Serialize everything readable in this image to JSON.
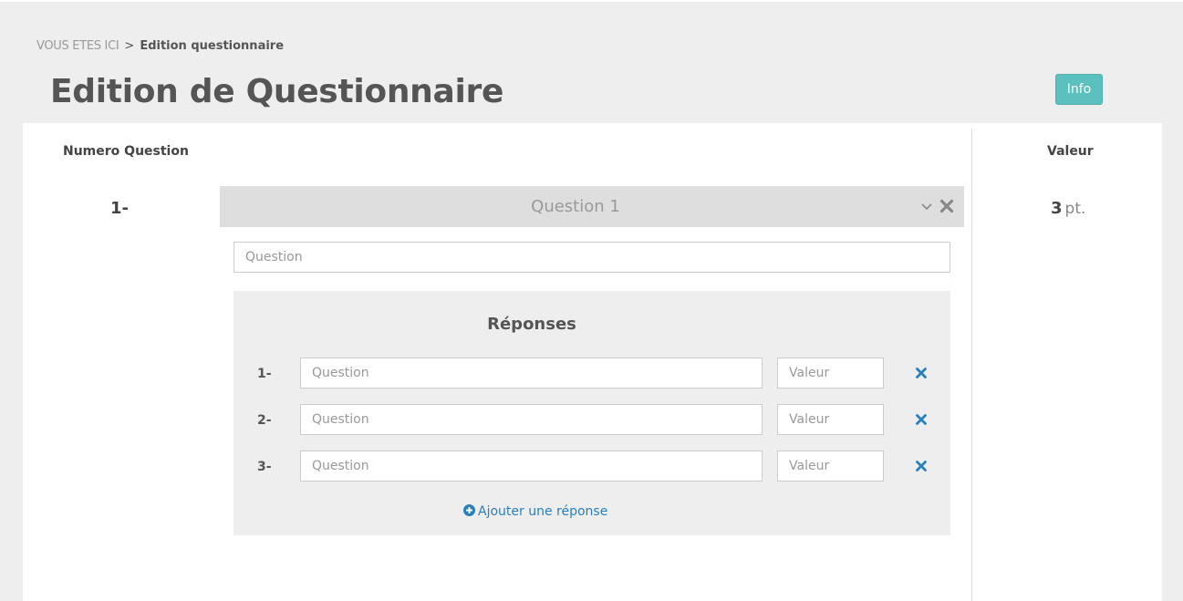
{
  "breadcrumb": {
    "root": "VOUS ETES ICI",
    "separator": ">",
    "current": "Edition questionnaire"
  },
  "page": {
    "title": "Edition de Questionnaire",
    "info_button_label": "Info"
  },
  "columns": {
    "number_header": "Numero Question",
    "value_header": "Valeur"
  },
  "question": {
    "number": "1-",
    "title": "Question 1",
    "input_placeholder": "Question",
    "value": "3",
    "value_unit": "pt."
  },
  "answers": {
    "title": "Réponses",
    "items": [
      {
        "number": "1-",
        "text_placeholder": "Question",
        "value_placeholder": "Valeur"
      },
      {
        "number": "2-",
        "text_placeholder": "Question",
        "value_placeholder": "Valeur"
      },
      {
        "number": "3-",
        "text_placeholder": "Question",
        "value_placeholder": "Valeur"
      }
    ],
    "add_label": "Ajouter une réponse"
  },
  "icons": {
    "collapse": "chevron-down-icon",
    "delete_question": "close-icon",
    "delete_answer": "close-icon",
    "add": "plus-circle-icon"
  },
  "colors": {
    "accent": "#5bc0be",
    "link": "#2a7fbf",
    "background": "#eeeeee"
  }
}
